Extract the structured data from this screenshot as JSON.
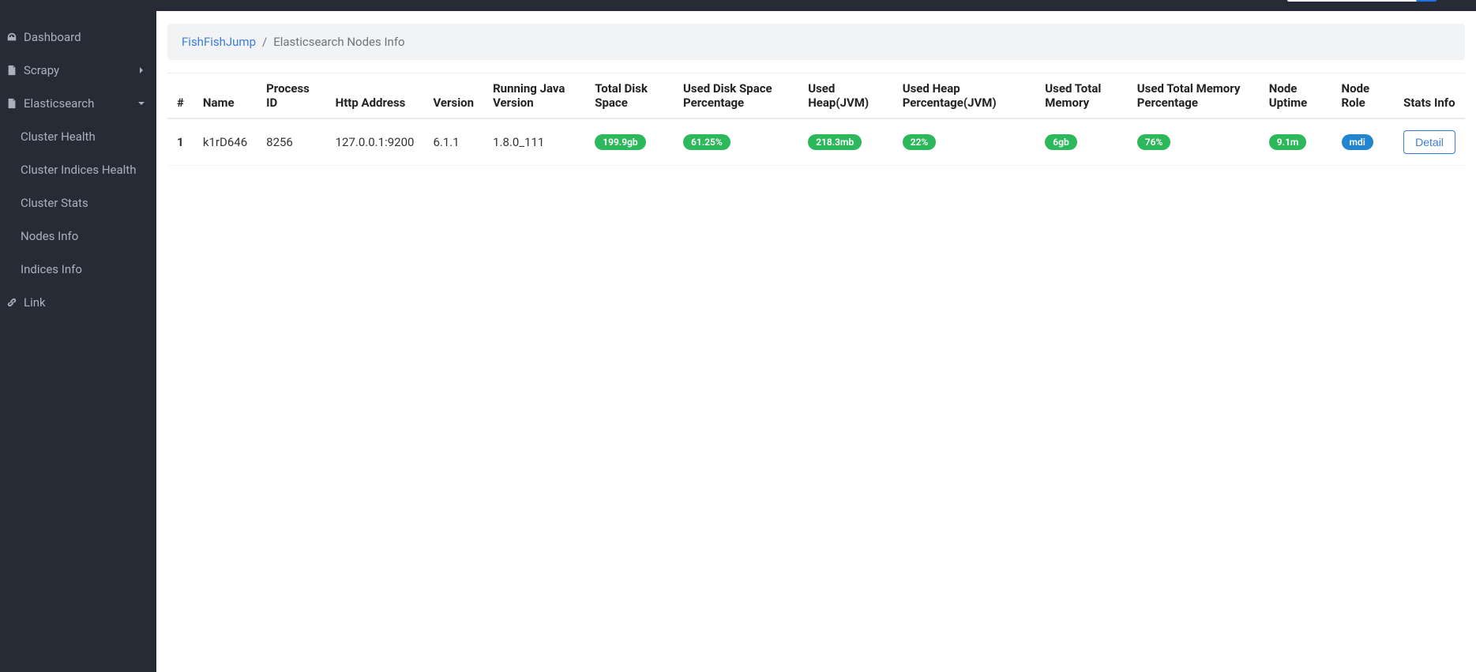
{
  "sidebar": {
    "dashboard": "Dashboard",
    "scrapy": "Scrapy",
    "elasticsearch": "Elasticsearch",
    "es_sub": {
      "cluster_health": "Cluster Health",
      "cluster_indices_health": "Cluster Indices Health",
      "cluster_stats": "Cluster Stats",
      "nodes_info": "Nodes Info",
      "indices_info": "Indices Info"
    },
    "link": "Link"
  },
  "breadcrumb": {
    "root": "FishFishJump",
    "sep": "/",
    "current": "Elasticsearch Nodes Info"
  },
  "table": {
    "headers": {
      "idx": "#",
      "name": "Name",
      "process_id": "Process ID",
      "http_address": "Http Address",
      "version": "Version",
      "java_version": "Running Java Version",
      "total_disk": "Total Disk Space",
      "used_disk_pct": "Used Disk Space Percentage",
      "used_heap": "Used Heap(JVM)",
      "used_heap_pct": "Used Heap Percentage(JVM)",
      "used_total_mem": "Used Total Memory",
      "used_total_mem_pct": "Used Total Memory Percentage",
      "node_uptime": "Node Uptime",
      "node_role": "Node Role",
      "stats_info": "Stats Info"
    },
    "rows": [
      {
        "idx": "1",
        "name": "k1rD646",
        "process_id": "8256",
        "http_address": "127.0.0.1:9200",
        "version": "6.1.1",
        "java_version": "1.8.0_111",
        "total_disk": "199.9gb",
        "used_disk_pct": "61.25%",
        "used_heap": "218.3mb",
        "used_heap_pct": "22%",
        "used_total_mem": "6gb",
        "used_total_mem_pct": "76%",
        "node_uptime": "9.1m",
        "node_role": "mdi",
        "detail_label": "Detail"
      }
    ]
  },
  "colors": {
    "sidebar_bg": "#272b35",
    "badge_green": "#2eb85c",
    "badge_blue": "#2185d0",
    "link_blue": "#3b7ddd"
  }
}
